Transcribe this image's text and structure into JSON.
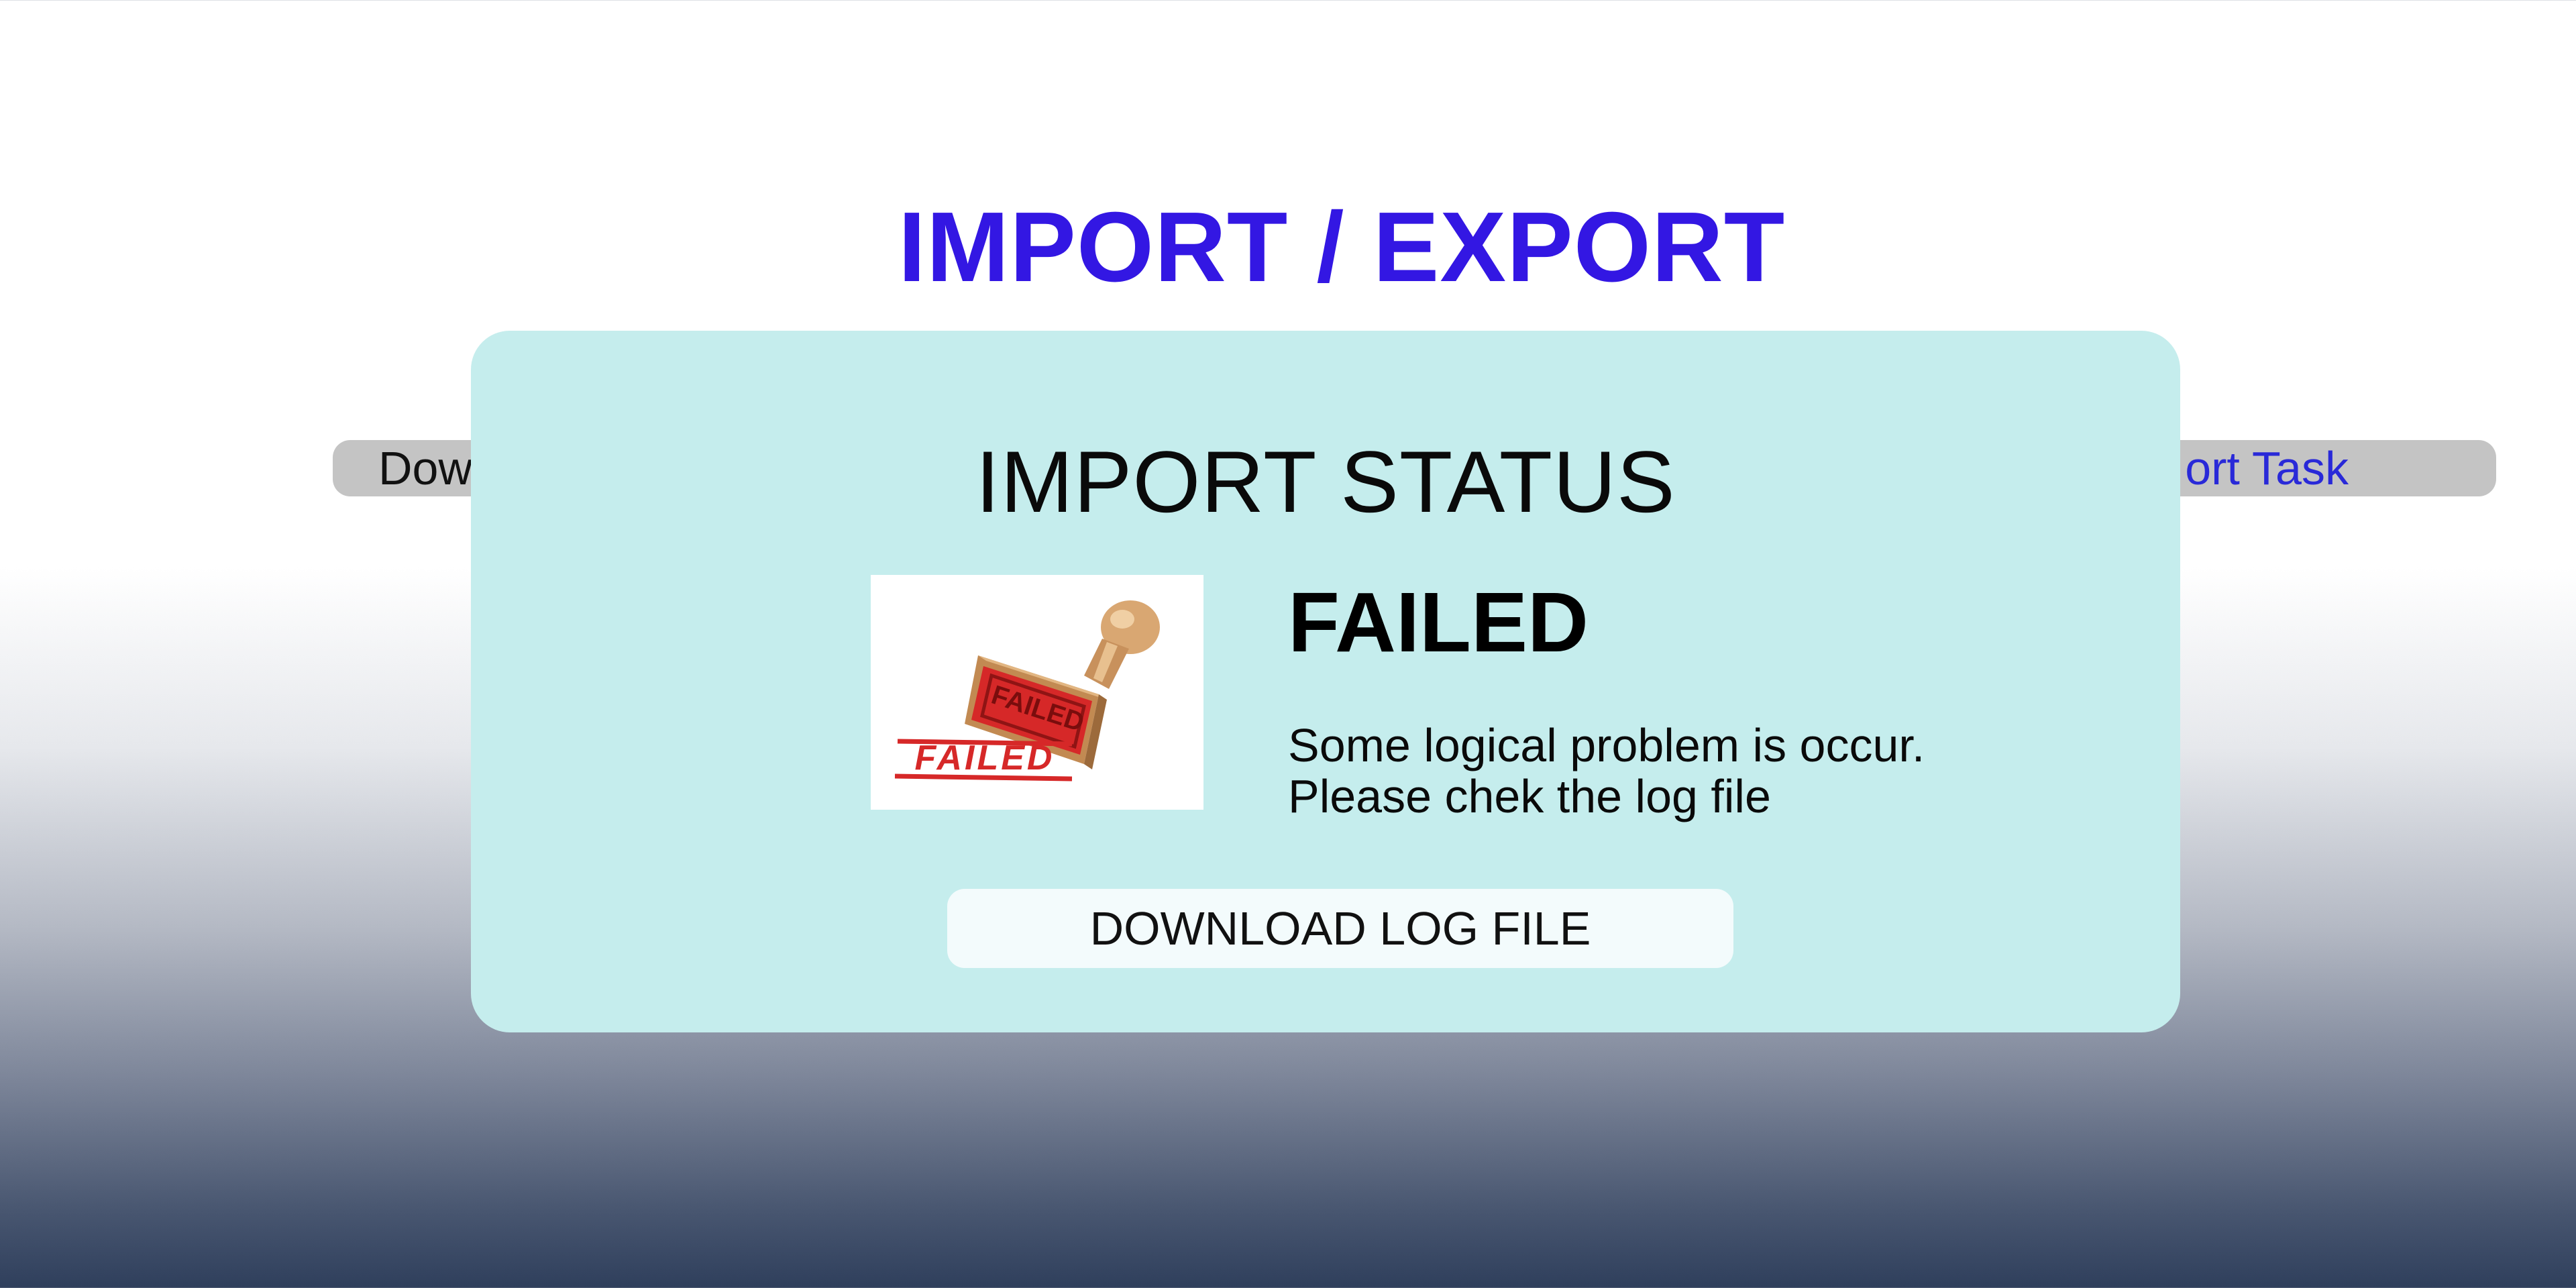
{
  "page": {
    "title": "IMPORT / EXPORT"
  },
  "tabs": {
    "left_label": "Dow",
    "right_label": "ort Task"
  },
  "modal": {
    "title": "IMPORT STATUS",
    "status": "FAILED",
    "message_line1": "Some logical problem is occur.",
    "message_line2": "Please chek the log file",
    "stamp_image": {
      "icon": "failed-stamp-icon",
      "text": "FAILED"
    },
    "download_button_label": "DOWNLOAD LOG FILE"
  },
  "colors": {
    "title": "#3317e3",
    "tab_bar": "#c4c4c4",
    "tab_link": "#2929d8",
    "modal_bg": "#c5eded",
    "button_bg": "#f3fbfc",
    "stamp_red": "#d62828"
  }
}
